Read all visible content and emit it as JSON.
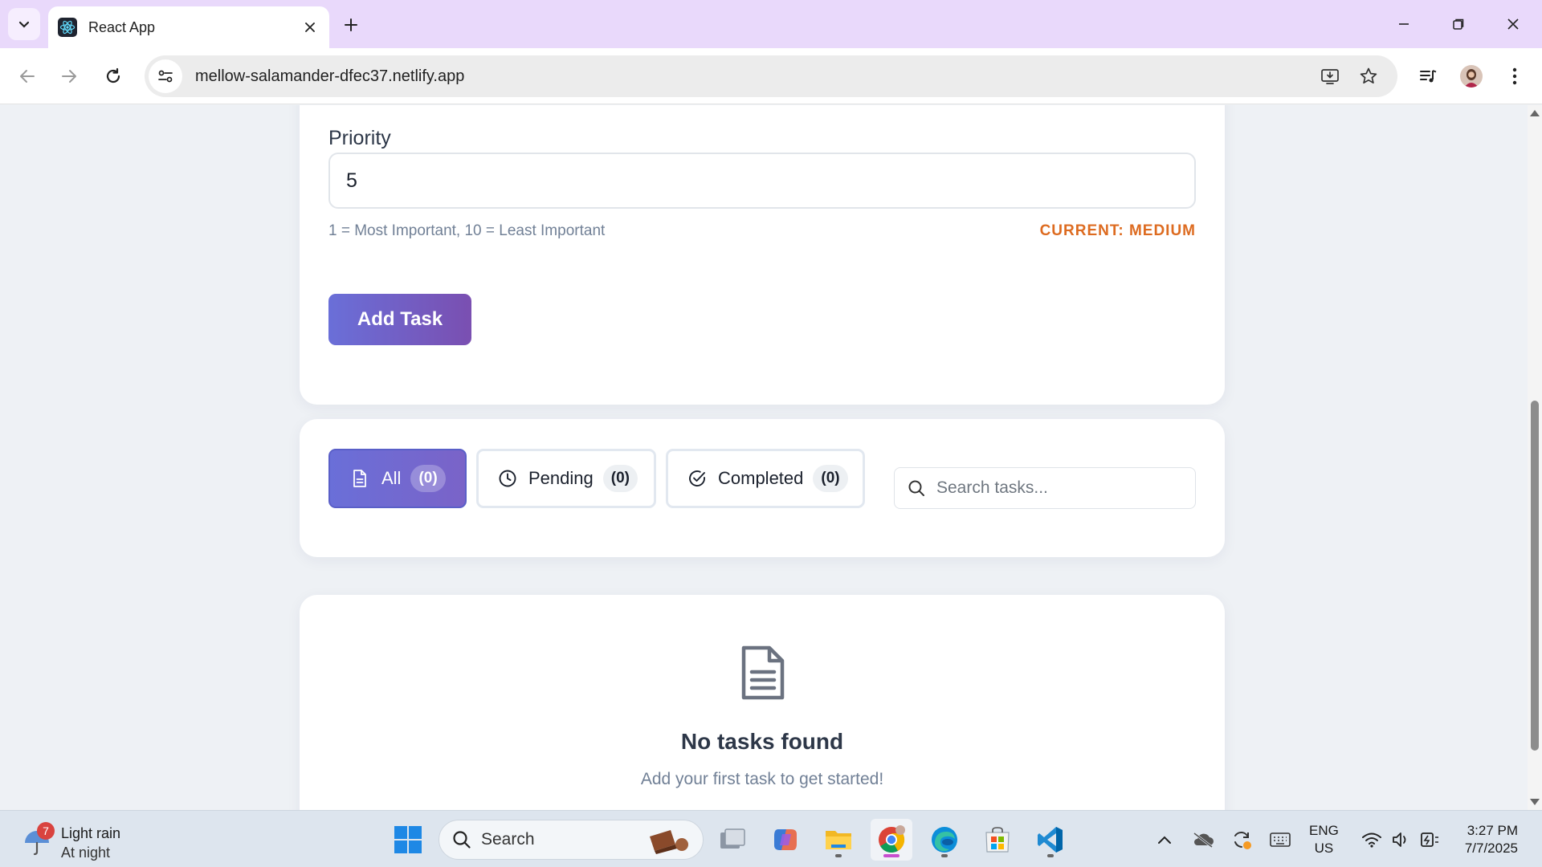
{
  "browser": {
    "tab_title": "React App",
    "url": "mellow-salamander-dfec37.netlify.app"
  },
  "form": {
    "priority_label": "Priority",
    "priority_value": "5",
    "priority_hint": "1 = Most Important, 10 = Least Important",
    "priority_current": "CURRENT: MEDIUM",
    "add_button": "Add Task"
  },
  "filters": {
    "tabs": [
      {
        "label": "All",
        "count": "(0)",
        "icon": "document-icon",
        "active": true
      },
      {
        "label": "Pending",
        "count": "(0)",
        "icon": "clock-icon",
        "active": false
      },
      {
        "label": "Completed",
        "count": "(0)",
        "icon": "check-circle-icon",
        "active": false
      }
    ],
    "search_placeholder": "Search tasks..."
  },
  "empty_state": {
    "title": "No tasks found",
    "subtitle": "Add your first task to get started!"
  },
  "taskbar": {
    "weather_badge": "7",
    "weather_line1": "Light rain",
    "weather_line2": "At night",
    "search_placeholder": "Search",
    "lang_line1": "ENG",
    "lang_line2": "US",
    "time": "3:27 PM",
    "date": "7/7/2025"
  },
  "colors": {
    "accent_gradient_start": "#6a6fd8",
    "accent_gradient_end": "#7a4fb1",
    "priority_current": "#dd6b20",
    "tabbar": "#e9d9fb"
  }
}
